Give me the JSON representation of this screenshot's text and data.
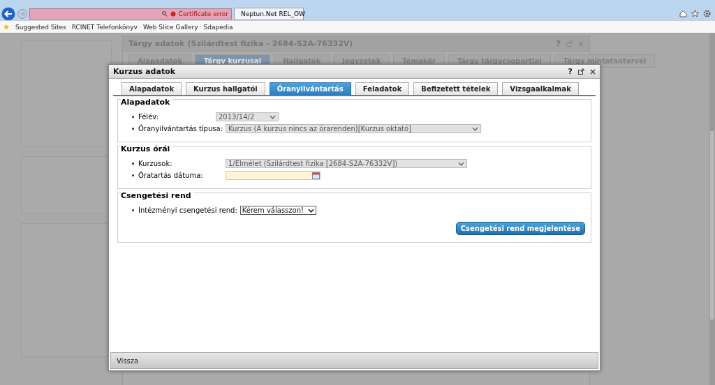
{
  "browser": {
    "address": {
      "status": "Certificate error"
    },
    "tabs": [
      {
        "label": "Neptun.Net REL_OW",
        "selected": true
      }
    ],
    "favorites": [
      "Suggested Sites",
      "RCINET Telefonkönyv",
      "Web Slice Gallery",
      "Sdapedia"
    ]
  },
  "background_dialog": {
    "title": "Tárgy adatok (Szilárdtest fizika - 2684-S2A-76332V)",
    "help": "?",
    "tabs": [
      {
        "label": "Alapadatok",
        "selected": false
      },
      {
        "label": "Tárgy kurzusai",
        "selected": true
      },
      {
        "label": "Hallgatók",
        "selected": false
      },
      {
        "label": "Jegyzetek",
        "selected": false
      },
      {
        "label": "Témakör",
        "selected": false
      },
      {
        "label": "Tárgy tárgycsoportjai",
        "selected": false
      },
      {
        "label": "Tárgy mintatantervei",
        "selected": false
      }
    ]
  },
  "dialog": {
    "title": "Kurzus adatok",
    "help": "?",
    "tabs": [
      {
        "label": "Alapadatok",
        "selected": false
      },
      {
        "label": "Kurzus hallgatói",
        "selected": false
      },
      {
        "label": "Óranyilvántartás",
        "selected": true
      },
      {
        "label": "Feladatok",
        "selected": false
      },
      {
        "label": "Befizetett tételek",
        "selected": false
      },
      {
        "label": "Vizsgaalkalmak",
        "selected": false
      }
    ],
    "sections": [
      {
        "title": "Alapadatok",
        "fields": [
          {
            "label": "Félév:",
            "kind": "select",
            "value": "2013/14/2",
            "disabled": true
          },
          {
            "label": "Óranyilvántartás típusa:",
            "kind": "select",
            "value": "Kurzus (A kurzus nincs az órarenden)[Kurzus oktató]",
            "disabled": true
          }
        ]
      },
      {
        "title": "Kurzus órái",
        "fields": [
          {
            "label": "Kurzusok:",
            "kind": "select",
            "value": "1/Elmélet (Szilárdtest fizika [2684-S2A-76332V])",
            "disabled": true
          },
          {
            "label": "Óratartás dátuma:",
            "kind": "date"
          }
        ]
      },
      {
        "title": "Csengetési rend",
        "fields": [
          {
            "label": "Intézményi csengetési rend:",
            "kind": "select",
            "value": "Kérem válasszon!",
            "disabled": false
          }
        ],
        "button": "Csengetési rend megjelentése"
      }
    ],
    "back_button": "Vissza"
  }
}
